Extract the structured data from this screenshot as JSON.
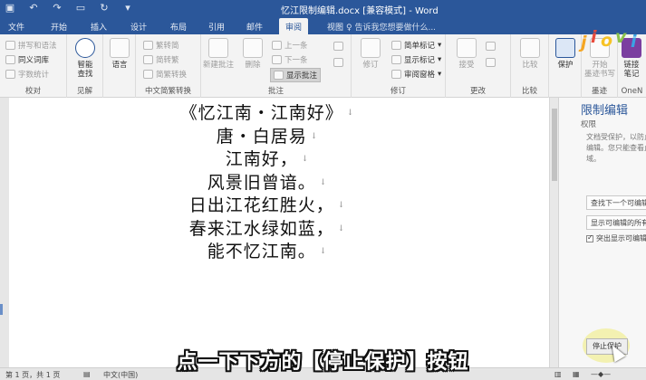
{
  "window": {
    "title": "忆江限制编辑.docx [兼容模式] - Word",
    "qat_icons": [
      "save-icon",
      "undo-icon",
      "redo-icon",
      "draft-icon",
      "refresh-icon",
      "customize-icon"
    ]
  },
  "tabs": [
    "文件",
    "开始",
    "插入",
    "设计",
    "布局",
    "引用",
    "邮件",
    "审阅",
    "视图"
  ],
  "active_tab": "审阅",
  "tell_me": "♀ 告诉我您想要做什么...",
  "ribbon": {
    "proofing": {
      "label": "校对",
      "items": [
        "拼写和语法",
        "同义词库",
        "字数统计"
      ]
    },
    "insights": {
      "label": "见解",
      "smart_lookup": "智能\n查找"
    },
    "language": {
      "label": "",
      "language": "语言"
    },
    "chinese_conversion": {
      "label": "中文简繁转换",
      "items": [
        "繁转简",
        "简转繁",
        "简繁转换"
      ]
    },
    "comments": {
      "label": "批注",
      "new_comment": "新建批注",
      "delete": "删除",
      "previous": "上一条",
      "next": "下一条",
      "show_comments": "显示批注"
    },
    "tracking": {
      "label": "修订",
      "track_changes": "修订",
      "simple_markup": "简单标记",
      "show_markup": "显示标记",
      "reviewing_pane": "审阅窗格"
    },
    "changes": {
      "label": "更改",
      "accept": "接受"
    },
    "compare": {
      "label": "比较",
      "compare": "比较"
    },
    "protect": {
      "label": "",
      "protect": "保护"
    },
    "ink": {
      "label": "墨迹",
      "start_inking": "开始\n墨迹书写"
    },
    "onenote": {
      "label": "OneN",
      "linked_notes": "链接\n笔记"
    }
  },
  "document": {
    "lines": [
      "《忆江南・江南好》",
      "唐・白居易",
      "江南好，",
      "风景旧曾谙。",
      "日出江花红胜火，",
      "春来江水绿如蓝，",
      "能不忆江南。"
    ]
  },
  "restrict_pane": {
    "title": "限制编辑",
    "subtitle": "权限",
    "description": "文档受保护，以防止意外编辑。您只能查看此区域。",
    "find_next": "查找下一个可编辑的区域",
    "show_all": "显示可编辑的所有区域",
    "highlight_label": "突出显示可编辑的区域",
    "stop_protection": "停止保护"
  },
  "status": {
    "page": "第 1 页，共 1 页",
    "language": "中文(中国)"
  },
  "caption": "点一下下方的【停止保护】按钮",
  "logo": {
    "text": "jiovi",
    "colors": [
      "#f5a623",
      "#e94b3c",
      "#f7c325",
      "#8bc34a",
      "#3aa3e3"
    ]
  }
}
